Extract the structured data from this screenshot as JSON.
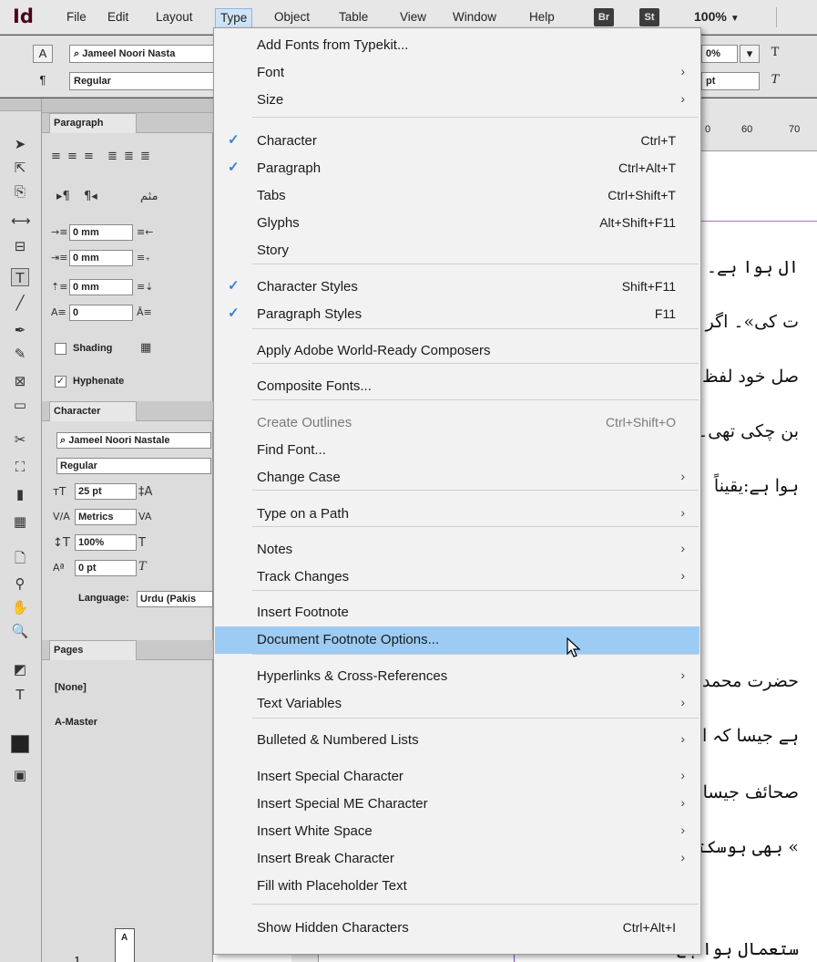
{
  "menubar": {
    "logo": "Id",
    "items": [
      "File",
      "Edit",
      "Layout",
      "Type",
      "Object",
      "Table",
      "View",
      "Window",
      "Help"
    ],
    "badges": [
      "Br",
      "St"
    ],
    "zoom": "100%"
  },
  "controlbar": {
    "font_name": "Jameel Noori Nasta",
    "font_style": "Regular",
    "right_value": "0%",
    "right_value2": "pt"
  },
  "paragraph_panel": {
    "tab": "Paragraph",
    "left_indent": "0 mm",
    "first_line_indent": "0 mm",
    "space_before": "0 mm",
    "drop_cap_lines": "0",
    "shading_label": "Shading",
    "hyphenate_label": "Hyphenate"
  },
  "character_panel": {
    "tab": "Character",
    "font_name": "Jameel Noori Nastale",
    "font_style": "Regular",
    "font_size": "25 pt",
    "kerning": "Metrics",
    "vertical_scale": "100%",
    "baseline_shift": "0 pt",
    "language_label": "Language:",
    "language_value": "Urdu (Pakis"
  },
  "pages_panel": {
    "tab": "Pages",
    "none_label": "[None]",
    "master_label": "A-Master",
    "thumb_label": "A",
    "page_number": "1"
  },
  "ruler": {
    "numbers": [
      "0",
      "60",
      "70"
    ]
  },
  "document": {
    "urdu_lines": [
      "ال ہوا ہے۔",
      "ت کی»۔ اگر",
      "صل خود لفظ",
      "بن چکی تھی۔",
      "ہوا ہے:یقیناً",
      "حضرت محمد",
      "ہے جیسا کہ ا",
      "صحائف جیسا",
      "» بھی ہوسکتا",
      "ستعمال ہوا ہے"
    ]
  },
  "type_menu": {
    "items": [
      {
        "label": "Add Fonts from Typekit...",
        "shortcut": "",
        "submenu": false,
        "checked": false,
        "disabled": false
      },
      {
        "label": "Font",
        "shortcut": "",
        "submenu": true,
        "checked": false,
        "disabled": false
      },
      {
        "label": "Size",
        "shortcut": "",
        "submenu": true,
        "checked": false,
        "disabled": false
      },
      {
        "label": "Character",
        "shortcut": "Ctrl+T",
        "submenu": false,
        "checked": true,
        "disabled": false
      },
      {
        "label": "Paragraph",
        "shortcut": "Ctrl+Alt+T",
        "submenu": false,
        "checked": true,
        "disabled": false
      },
      {
        "label": "Tabs",
        "shortcut": "Ctrl+Shift+T",
        "submenu": false,
        "checked": false,
        "disabled": false
      },
      {
        "label": "Glyphs",
        "shortcut": "Alt+Shift+F11",
        "submenu": false,
        "checked": false,
        "disabled": false
      },
      {
        "label": "Story",
        "shortcut": "",
        "submenu": false,
        "checked": false,
        "disabled": false
      },
      {
        "label": "Character Styles",
        "shortcut": "Shift+F11",
        "submenu": false,
        "checked": true,
        "disabled": false
      },
      {
        "label": "Paragraph Styles",
        "shortcut": "F11",
        "submenu": false,
        "checked": true,
        "disabled": false
      },
      {
        "label": "Apply Adobe World-Ready Composers",
        "shortcut": "",
        "submenu": false,
        "checked": false,
        "disabled": false
      },
      {
        "label": "Composite Fonts...",
        "shortcut": "",
        "submenu": false,
        "checked": false,
        "disabled": false
      },
      {
        "label": "Create Outlines",
        "shortcut": "Ctrl+Shift+O",
        "submenu": false,
        "checked": false,
        "disabled": true
      },
      {
        "label": "Find Font...",
        "shortcut": "",
        "submenu": false,
        "checked": false,
        "disabled": false
      },
      {
        "label": "Change Case",
        "shortcut": "",
        "submenu": true,
        "checked": false,
        "disabled": false
      },
      {
        "label": "Type on a Path",
        "shortcut": "",
        "submenu": true,
        "checked": false,
        "disabled": false
      },
      {
        "label": "Notes",
        "shortcut": "",
        "submenu": true,
        "checked": false,
        "disabled": false
      },
      {
        "label": "Track Changes",
        "shortcut": "",
        "submenu": true,
        "checked": false,
        "disabled": false
      },
      {
        "label": "Insert Footnote",
        "shortcut": "",
        "submenu": false,
        "checked": false,
        "disabled": false
      },
      {
        "label": "Document Footnote Options...",
        "shortcut": "",
        "submenu": false,
        "checked": false,
        "disabled": false,
        "highlighted": true
      },
      {
        "label": "Hyperlinks & Cross-References",
        "shortcut": "",
        "submenu": true,
        "checked": false,
        "disabled": false
      },
      {
        "label": "Text Variables",
        "shortcut": "",
        "submenu": true,
        "checked": false,
        "disabled": false
      },
      {
        "label": "Bulleted & Numbered Lists",
        "shortcut": "",
        "submenu": true,
        "checked": false,
        "disabled": false
      },
      {
        "label": "Insert Special Character",
        "shortcut": "",
        "submenu": true,
        "checked": false,
        "disabled": false
      },
      {
        "label": "Insert Special ME Character",
        "shortcut": "",
        "submenu": true,
        "checked": false,
        "disabled": false
      },
      {
        "label": "Insert White Space",
        "shortcut": "",
        "submenu": true,
        "checked": false,
        "disabled": false
      },
      {
        "label": "Insert Break Character",
        "shortcut": "",
        "submenu": true,
        "checked": false,
        "disabled": false
      },
      {
        "label": "Fill with Placeholder Text",
        "shortcut": "",
        "submenu": false,
        "checked": false,
        "disabled": false
      },
      {
        "label": "Show Hidden Characters",
        "shortcut": "Ctrl+Alt+I",
        "submenu": false,
        "checked": false,
        "disabled": false
      }
    ]
  }
}
